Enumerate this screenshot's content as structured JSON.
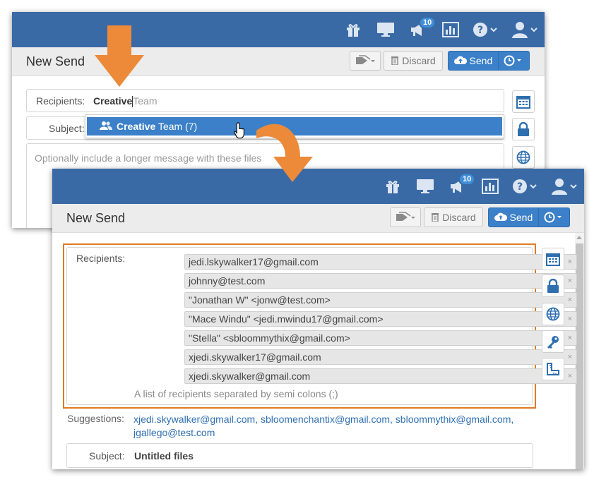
{
  "colors": {
    "topbar": "#3a6aa6",
    "primary": "#3b80c8",
    "highlight": "#e07b22",
    "arrow": "#ec8a3a"
  },
  "toolbar": {
    "badge_count": "10"
  },
  "back": {
    "title": "New Send",
    "discard_label": "Discard",
    "send_label": "Send",
    "recipients_label": "Recipients:",
    "typed_text": "Creative",
    "autocomplete_ghost": "Team",
    "dropdown_bold": "Creative",
    "dropdown_rest": " Team (7)",
    "subject_label": "Subject:",
    "message_placeholder": "Optionally include a longer message with these files"
  },
  "front": {
    "title": "New Send",
    "discard_label": "Discard",
    "send_label": "Send",
    "recipients_label": "Recipients:",
    "recipients": [
      "jedi.lskywalker17@gmail.com",
      "johnny@test.com",
      "\"Jonathan W\" <jonw@test.com>",
      "\"Mace Windu\" <jedi.mwindu17@gmail.com>",
      "\"Stella\" <sbloommythix@gmail.com>",
      "xjedi.skywalker17@gmail.com",
      "xjedi.skywalker@gmail.com"
    ],
    "remove_symbol": "×",
    "recipients_hint": "A list of recipients separated by semi colons (;)",
    "suggestions_label": "Suggestions:",
    "suggestions": [
      "xjedi.skywalker@gmail.com,",
      "sbloomenchantix@gmail.com,",
      "sbloommythix@gmail.com,",
      "jgallego@test.com"
    ],
    "subject_label": "Subject:",
    "subject_value": "Untitled files"
  }
}
